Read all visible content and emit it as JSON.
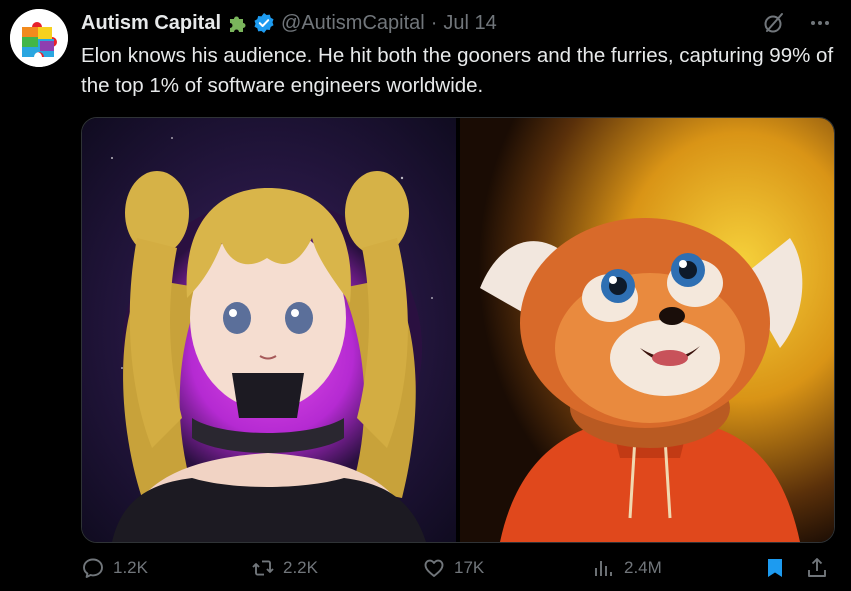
{
  "author": {
    "display_name": "Autism Capital",
    "handle": "@AutismCapital",
    "separator": "·",
    "date": "Jul 14",
    "emoji_icon": "puzzle-piece-icon",
    "verified_icon": "verified-badge-icon",
    "avatar_icon": "rainbow-puzzle-icon"
  },
  "tweet": {
    "text": "Elon knows his audience. He hit both the gooners and the furries, capturing 99% of the top 1% of software engineers worldwide."
  },
  "media": {
    "left_image": "anime-girl-image",
    "right_image": "red-panda-hoodie-image"
  },
  "actions": {
    "replies": "1.2K",
    "reposts": "2.2K",
    "likes": "17K",
    "views": "2.4M"
  },
  "colors": {
    "background": "#000000",
    "text": "#e7e9ea",
    "muted": "#71767b",
    "accent": "#1d9bf0"
  }
}
